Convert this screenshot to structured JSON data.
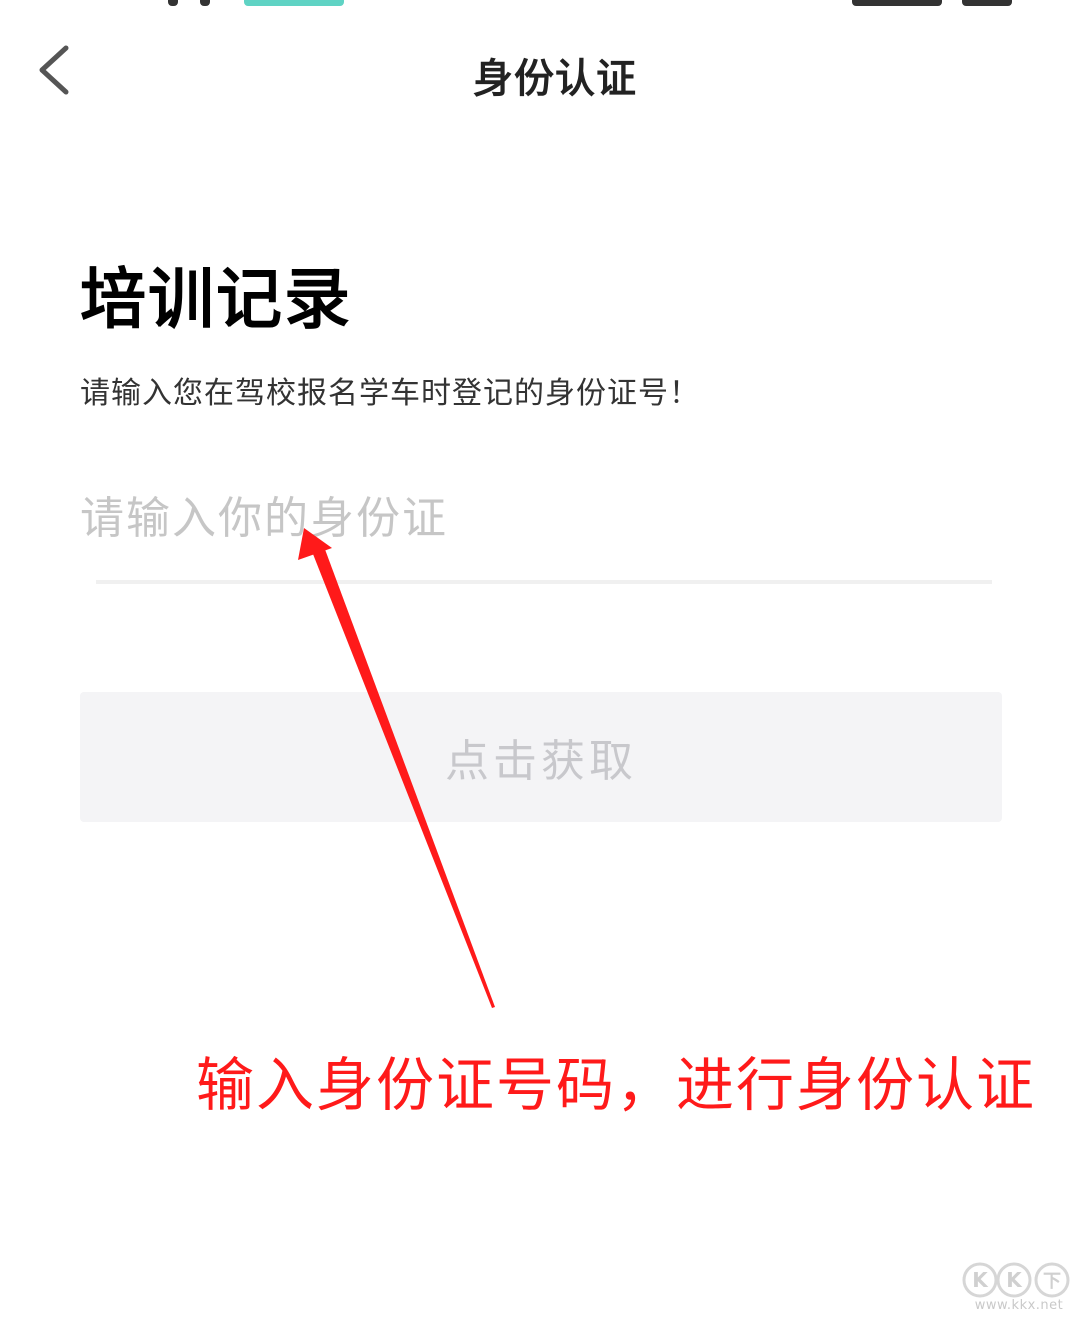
{
  "header": {
    "title": "身份认证",
    "back_icon": "chevron-left-icon"
  },
  "main": {
    "heading": "培训记录",
    "instruction": "请输入您在驾校报名学车时登记的身份证号！",
    "id_input": {
      "value": "",
      "placeholder": "请输入你的身份证"
    },
    "fetch_button": {
      "label": "点击获取",
      "state": "disabled"
    }
  },
  "annotation": {
    "text": "输入身份证号码，进行身份认证",
    "color": "#ff1a1a"
  },
  "watermark": {
    "logo_text": "KK下载",
    "url": "www.kkx.net"
  },
  "colors": {
    "background": "#ffffff",
    "title": "#222222",
    "placeholder": "#c6c6c6",
    "button_bg": "#f4f4f6",
    "button_text_disabled": "#c8c8cc",
    "annotation_red": "#ff1a1a"
  }
}
